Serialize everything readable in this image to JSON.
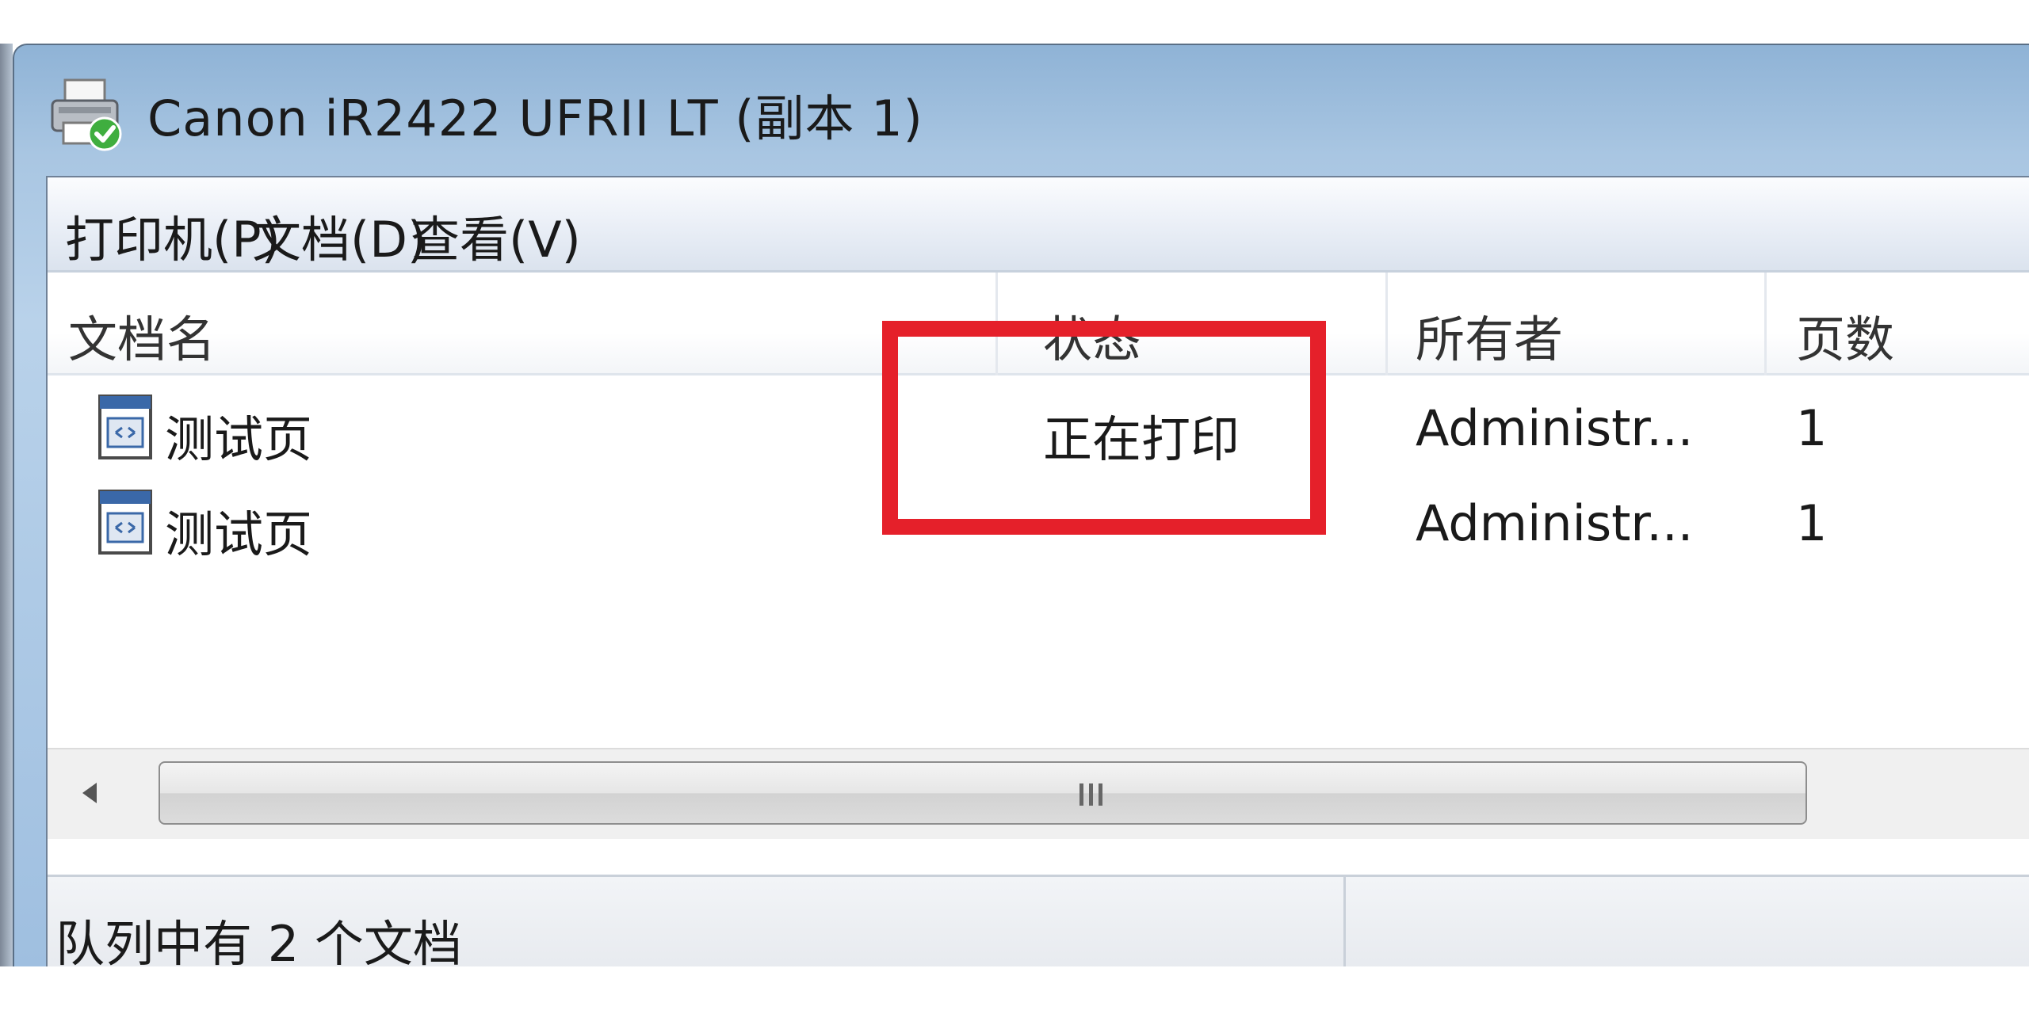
{
  "window": {
    "title": "Canon iR2422 UFRII LT (副本 1)",
    "icon": "printer-icon"
  },
  "menubar": {
    "items": [
      {
        "label": "打印机(P)"
      },
      {
        "label": "文档(D)"
      },
      {
        "label": "查看(V)"
      }
    ]
  },
  "columns": {
    "name": "文档名",
    "status": "状态",
    "owner": "所有者",
    "pages": "页数"
  },
  "rows": [
    {
      "name": "测试页",
      "status": "正在打印",
      "owner": "Administr...",
      "pages": "1",
      "icon": "document-icon"
    },
    {
      "name": "测试页",
      "status": "",
      "owner": "Administr...",
      "pages": "1",
      "icon": "document-icon"
    }
  ],
  "scrollbar": {
    "grip": "III"
  },
  "statusbar": {
    "text": "队列中有 2 个文档"
  },
  "colors": {
    "highlight": "#e5202a",
    "titlebar": "#a9c6e2"
  }
}
